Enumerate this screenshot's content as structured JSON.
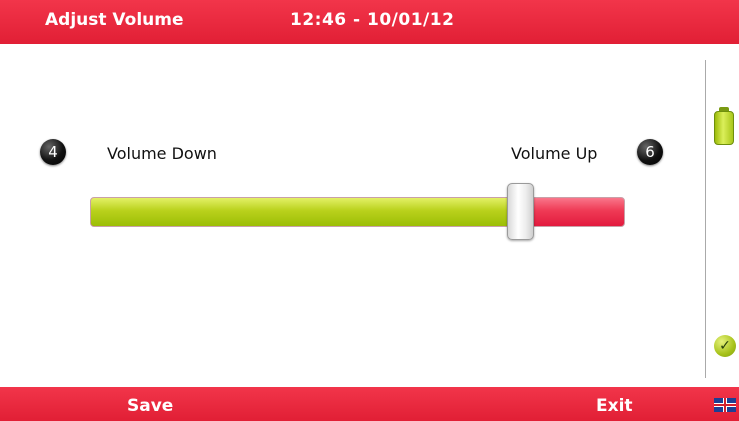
{
  "header": {
    "title": "Adjust Volume",
    "datetime": "12:46 - 10/01/12"
  },
  "volume": {
    "down_key": "4",
    "down_label": "Volume Down",
    "up_key": "6",
    "up_label": "Volume Up",
    "level_fraction": 0.805
  },
  "status": {
    "battery_icon": "battery-icon",
    "ok_icon": "check-icon"
  },
  "footer": {
    "save_label": "Save",
    "exit_label": "Exit",
    "language_icon": "uk-flag-icon"
  },
  "colors": {
    "bar_red": "#e11f35",
    "level_green": "#9cbe06",
    "level_remaining_red": "#ef3a55"
  }
}
